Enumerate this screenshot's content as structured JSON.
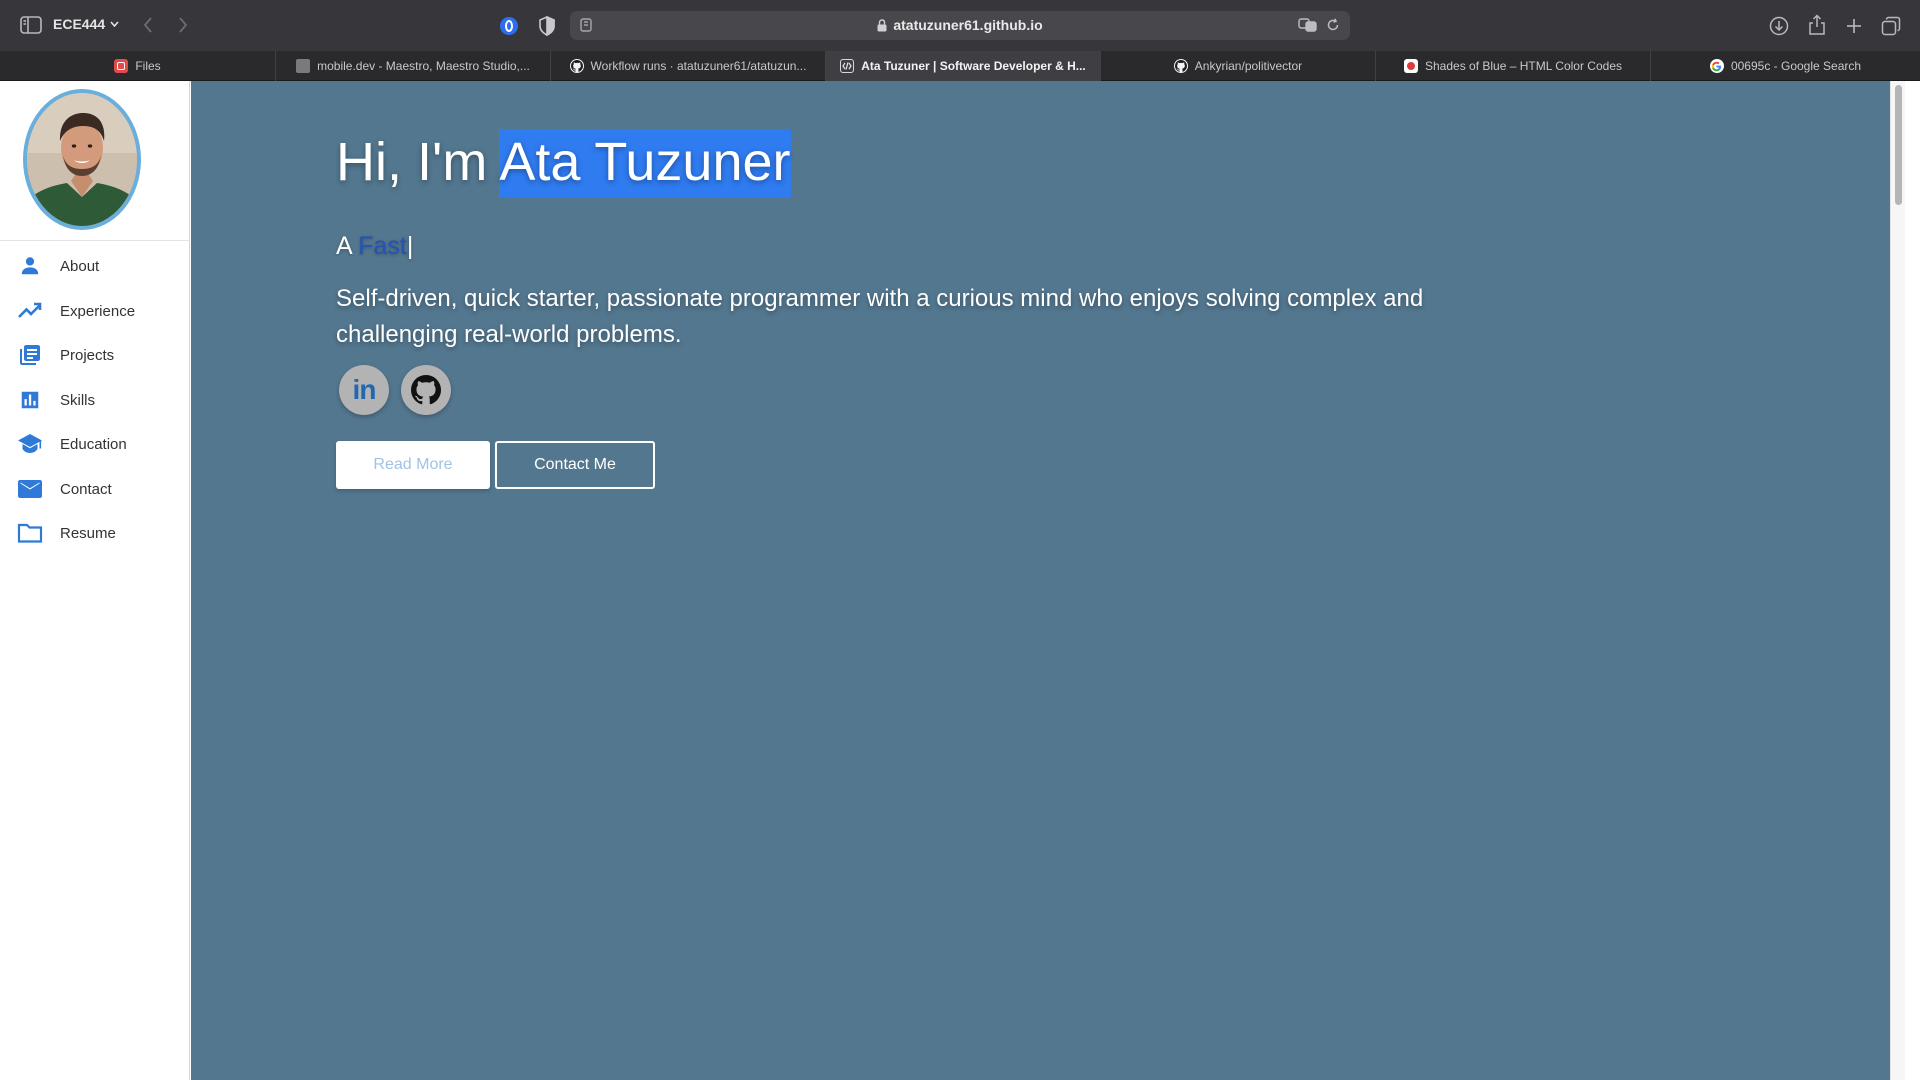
{
  "browser": {
    "tab_group": "ECE444",
    "url": "atatuzuner61.github.io",
    "tabs": [
      {
        "label": "Files",
        "icon": "files-favicon"
      },
      {
        "label": "mobile.dev - Maestro, Maestro Studio,...",
        "icon": "mobile-dev-favicon"
      },
      {
        "label": "Workflow runs · atatuzuner61/atatuzun...",
        "icon": "github-favicon"
      },
      {
        "label": "Ata Tuzuner | Software Developer & H...",
        "icon": "code-favicon",
        "active": true
      },
      {
        "label": "Ankyrian/politivector",
        "icon": "github-favicon"
      },
      {
        "label": "Shades of Blue – HTML Color Codes",
        "icon": "color-codes-favicon"
      },
      {
        "label": "00695c - Google Search",
        "icon": "google-favicon"
      }
    ]
  },
  "nav": {
    "items": [
      {
        "label": "About",
        "icon": "person-icon"
      },
      {
        "label": "Experience",
        "icon": "trending-up-icon"
      },
      {
        "label": "Projects",
        "icon": "library-books-icon"
      },
      {
        "label": "Skills",
        "icon": "bar-chart-icon"
      },
      {
        "label": "Education",
        "icon": "graduation-cap-icon"
      },
      {
        "label": "Contact",
        "icon": "email-icon"
      },
      {
        "label": "Resume",
        "icon": "folder-icon"
      }
    ]
  },
  "hero": {
    "greeting_prefix": "Hi, I'm ",
    "name": "Ata Tuzuner",
    "typed_prefix": "A ",
    "typed_word": "Fast",
    "caret": "|",
    "tagline": "Self-driven, quick starter, passionate programmer with a curious mind who enjoys solving complex and challenging real-world problems.",
    "social": [
      {
        "name": "LinkedIn",
        "glyph": "in"
      },
      {
        "name": "GitHub"
      }
    ],
    "read_more": "Read More",
    "contact_me": "Contact Me"
  },
  "colors": {
    "hero_bg": "#53778f",
    "accent_blue": "#2f7ad8",
    "name_highlight": "#2f7bf0",
    "typed_word": "#2352b8"
  }
}
